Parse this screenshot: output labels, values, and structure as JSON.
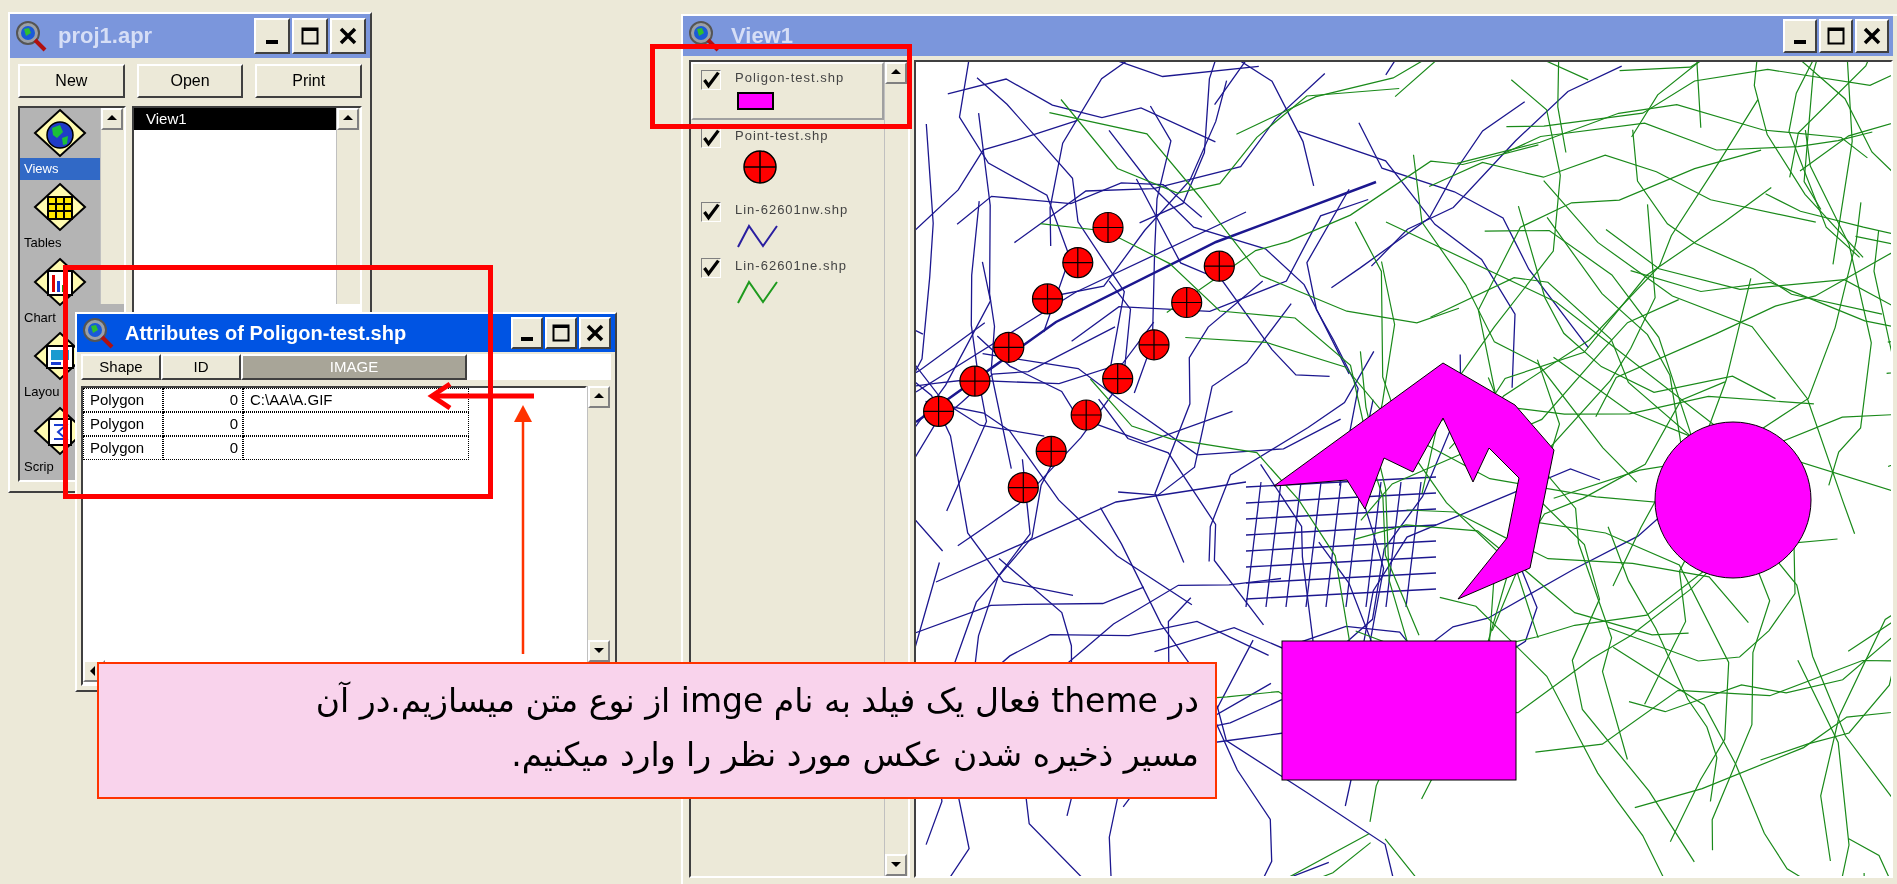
{
  "project_window": {
    "title": "proj1.apr",
    "active": false,
    "buttons": [
      "New",
      "Open",
      "Print"
    ],
    "categories": [
      {
        "label": "Views",
        "kind": "views",
        "selected": true
      },
      {
        "label": "Tables",
        "kind": "tables",
        "selected": false
      },
      {
        "label": "Chart",
        "kind": "charts",
        "selected": false
      },
      {
        "label": "Layou",
        "kind": "layouts",
        "selected": false
      },
      {
        "label": "Scrip",
        "kind": "scripts",
        "selected": false
      }
    ],
    "items": [
      {
        "label": "View1",
        "selected": true
      }
    ]
  },
  "attributes_window": {
    "title": "Attributes of Poligon-test.shp",
    "active": true,
    "columns": [
      {
        "label": "Shape",
        "selected": false
      },
      {
        "label": "ID",
        "selected": false
      },
      {
        "label": "IMAGE",
        "selected": true
      }
    ],
    "rows": [
      {
        "shape": "Polygon",
        "id": "0",
        "image": "C:\\AA\\A.GIF"
      },
      {
        "shape": "Polygon",
        "id": "0"
      },
      {
        "shape": "Polygon",
        "id": "0"
      }
    ]
  },
  "view_window": {
    "title": "View1",
    "active": false,
    "themes": [
      {
        "name": "Poligon-test.shp",
        "kind": "polygon",
        "color": "#ff00ff",
        "checked": true,
        "selected": true
      },
      {
        "name": "Point-test.shp",
        "kind": "point",
        "color": "#ff0000",
        "checked": true,
        "selected": false
      },
      {
        "name": "Lin-62601nw.shp",
        "kind": "line",
        "color": "#2a1fa0",
        "checked": true,
        "selected": false
      },
      {
        "name": "Lin-62601ne.shp",
        "kind": "line",
        "color": "#1e9a1e",
        "checked": true,
        "selected": false
      }
    ]
  },
  "callout": {
    "text": "در theme فعال یک فیلد به نام imge از نوع متن میسازیم.در آن مسیر ذخیره شدن عکس مورد نظر را وارد میکنیم."
  }
}
